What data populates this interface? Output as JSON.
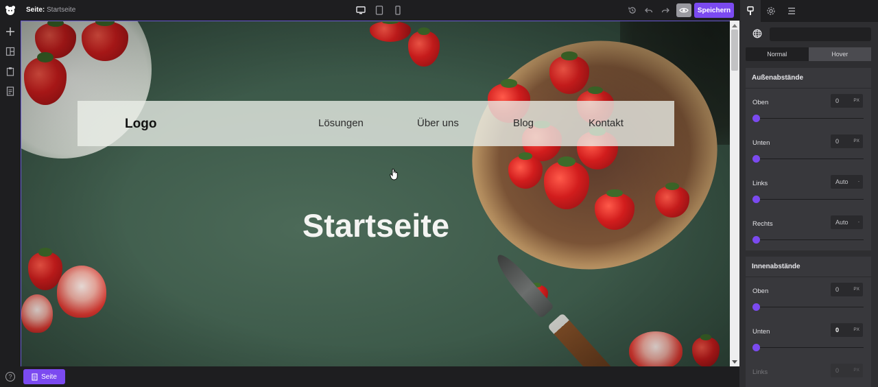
{
  "topbar": {
    "page_prefix": "Seite:",
    "page_name": "Startseite",
    "save_label": "Speichern"
  },
  "site": {
    "logo": "Logo",
    "nav": [
      "Lösungen",
      "Über uns",
      "Blog",
      "Kontakt"
    ],
    "hero_title": "Startseite"
  },
  "bottombar": {
    "help": "?",
    "page_button": "Seite"
  },
  "panel": {
    "state_tabs": [
      "Normal",
      "Hover"
    ],
    "active_state": "Hover",
    "margin": {
      "title": "Außenabstände",
      "rows": [
        {
          "label": "Oben",
          "value": "0",
          "unit": "PX"
        },
        {
          "label": "Unten",
          "value": "0",
          "unit": "PX"
        },
        {
          "label": "Links",
          "value": "Auto",
          "unit": "-"
        },
        {
          "label": "Rechts",
          "value": "Auto",
          "unit": "-"
        }
      ]
    },
    "padding": {
      "title": "Innenabstände",
      "rows": [
        {
          "label": "Oben",
          "value": "0",
          "unit": "PX"
        },
        {
          "label": "Unten",
          "value": "0",
          "unit": "PX"
        },
        {
          "label": "Links",
          "value": "0",
          "unit": "PX"
        }
      ]
    }
  },
  "colors": {
    "accent": "#7b4af0",
    "background": "#1e1e20",
    "panel": "#2e2e31"
  }
}
